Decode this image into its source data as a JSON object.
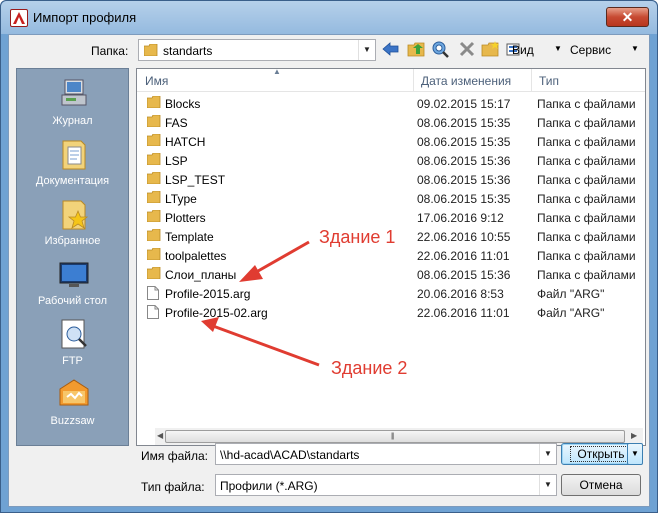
{
  "window": {
    "title": "Импорт профиля",
    "close_glyph": "✕"
  },
  "toolbar": {
    "folder_label": "Папка:",
    "folder_value": "standarts",
    "view_label": "Вид",
    "service_label": "Сервис",
    "icons": [
      "back-arrow-icon",
      "up-folder-icon",
      "search-web-icon",
      "delete-icon",
      "new-folder-icon",
      "views-icon"
    ]
  },
  "places": [
    {
      "label": "Журнал",
      "icon": "history-icon"
    },
    {
      "label": "Документация",
      "icon": "documents-icon"
    },
    {
      "label": "Избранное",
      "icon": "favorites-icon"
    },
    {
      "label": "Рабочий стол",
      "icon": "desktop-icon"
    },
    {
      "label": "FTP",
      "icon": "ftp-icon"
    },
    {
      "label": "Buzzsaw",
      "icon": "buzzsaw-icon"
    }
  ],
  "columns": {
    "name": "Имя",
    "date": "Дата изменения",
    "type": "Тип"
  },
  "files": [
    {
      "name": "Blocks",
      "date": "09.02.2015 15:17",
      "type": "Папка с файлами",
      "kind": "folder"
    },
    {
      "name": "FAS",
      "date": "08.06.2015 15:35",
      "type": "Папка с файлами",
      "kind": "folder"
    },
    {
      "name": "HATCH",
      "date": "08.06.2015 15:35",
      "type": "Папка с файлами",
      "kind": "folder"
    },
    {
      "name": "LSP",
      "date": "08.06.2015 15:36",
      "type": "Папка с файлами",
      "kind": "folder"
    },
    {
      "name": "LSP_TEST",
      "date": "08.06.2015 15:36",
      "type": "Папка с файлами",
      "kind": "folder"
    },
    {
      "name": "LType",
      "date": "08.06.2015 15:35",
      "type": "Папка с файлами",
      "kind": "folder"
    },
    {
      "name": "Plotters",
      "date": "17.06.2016 9:12",
      "type": "Папка с файлами",
      "kind": "folder"
    },
    {
      "name": "Template",
      "date": "22.06.2016 10:55",
      "type": "Папка с файлами",
      "kind": "folder"
    },
    {
      "name": "toolpalettes",
      "date": "22.06.2016 11:01",
      "type": "Папка с файлами",
      "kind": "folder"
    },
    {
      "name": "Слои_планы",
      "date": "08.06.2015 15:36",
      "type": "Папка с файлами",
      "kind": "folder"
    },
    {
      "name": "Profile-2015.arg",
      "date": "20.06.2016 8:53",
      "type": "Файл \"ARG\"",
      "kind": "file"
    },
    {
      "name": "Profile-2015-02.arg",
      "date": "22.06.2016 11:01",
      "type": "Файл \"ARG\"",
      "kind": "file"
    }
  ],
  "bottom": {
    "filename_label": "Имя файла:",
    "filename_value": "\\\\hd-acad\\ACAD\\standarts",
    "filetype_label": "Тип файла:",
    "filetype_value": "Профили (*.ARG)",
    "open_label": "Открыть",
    "cancel_label": "Отмена"
  },
  "annotations": {
    "label1": "Здание 1",
    "label2": "Здание 2",
    "color": "#e03c31"
  }
}
